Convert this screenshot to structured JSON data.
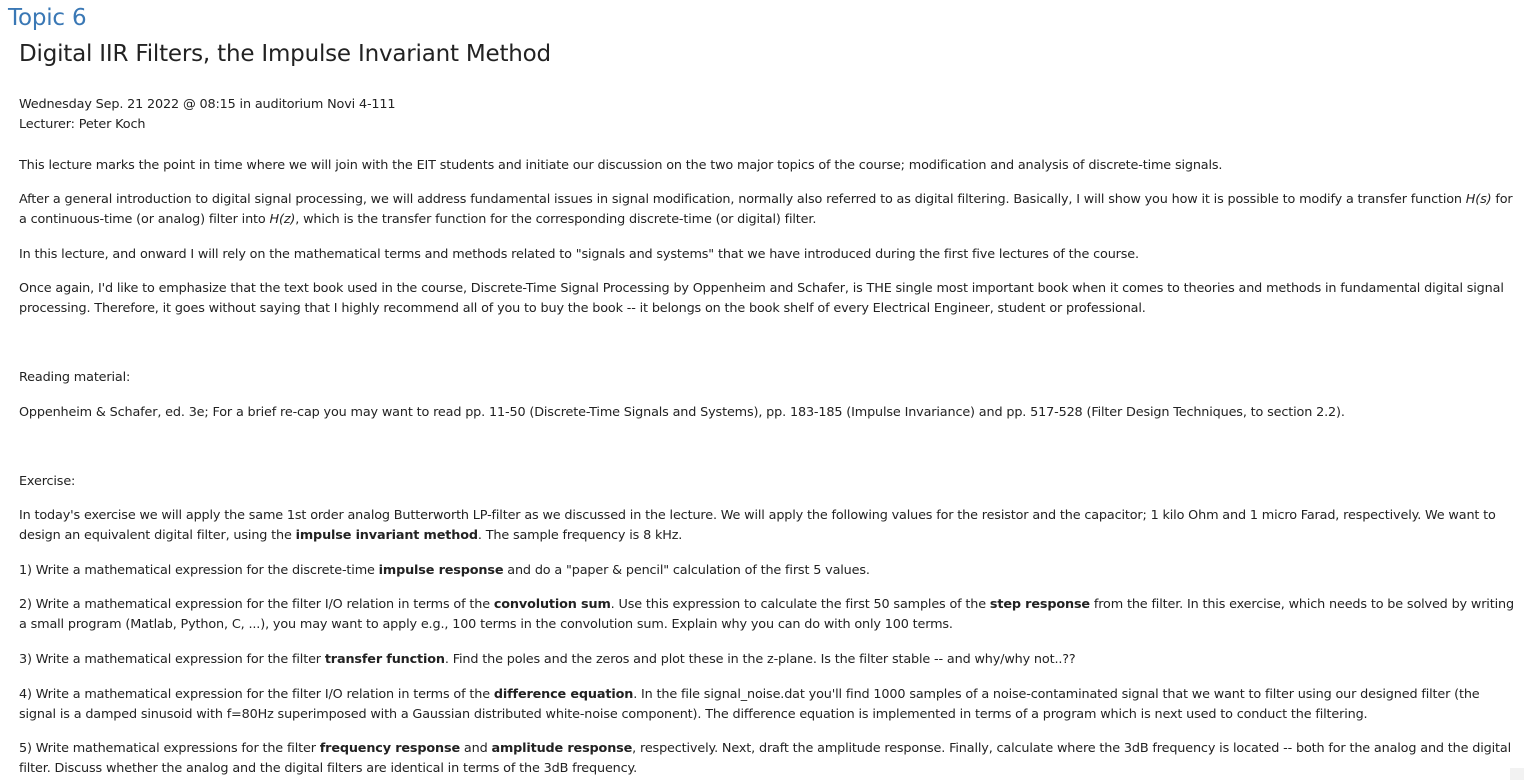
{
  "section": {
    "topic_link": "Topic 6",
    "title": "Digital IIR Filters, the Impulse Invariant Method"
  },
  "meta": {
    "date_line": "Wednesday Sep. 21 2022 @ 08:15 in auditorium Novi 4-111",
    "lecturer_line": "Lecturer: Peter Koch"
  },
  "intro": {
    "p1": "This lecture marks the point in time where we will join with the EIT students and initiate our discussion on the two major topics of the course; modification and analysis of discrete-time signals.",
    "p2_a": "After a general introduction to digital signal processing, we will address fundamental issues in signal modification, normally also referred to as digital filtering. Basically, I will show you how it is possible to modify a transfer function ",
    "p2_hs": "H(s)",
    "p2_b": " for a continuous-time (or analog) filter into ",
    "p2_hz": "H(z)",
    "p2_c": ", which is the transfer function for the corresponding discrete-time (or digital) filter.",
    "p3": "In this lecture, and onward I will rely on the mathematical terms and methods related to \"signals and systems\" that we have introduced during the first five lectures of the course.",
    "p4": "Once again, I'd like to emphasize that the text book used in the course, Discrete-Time Signal Processing by Oppenheim and Schafer, is THE single most important book when it comes to theories and methods in fundamental digital signal processing. Therefore, it goes without saying that I highly recommend all of you to buy the book -- it belongs on the book shelf of every Electrical Engineer, student or professional."
  },
  "reading": {
    "heading": "Reading material:",
    "text": "Oppenheim & Schafer, ed. 3e; For a brief re-cap you may want to read pp. 11-50 (Discrete-Time Signals and Systems), pp. 183-185 (Impulse Invariance) and pp. 517-528 (Filter Design Techniques, to section 2.2)."
  },
  "exercise": {
    "heading": "Exercise:",
    "intro_a": "In today's exercise we will apply the same 1st order analog Butterworth LP-filter as we discussed in the lecture. We will apply the following values for the resistor and the capacitor; 1 kilo Ohm and 1 micro Farad, respectively. We want to design an equivalent digital filter, using the ",
    "intro_bold": "impulse invariant method",
    "intro_b": ". The sample frequency is 8 kHz.",
    "q1_a": "1) Write a mathematical expression for the discrete-time ",
    "q1_bold": "impulse response",
    "q1_b": " and do a \"paper & pencil\" calculation of the first 5 values.",
    "q2_a": "2) Write a mathematical expression for the filter I/O relation in terms of the ",
    "q2_bold1": "convolution sum",
    "q2_b": ". Use this expression to calculate the first 50 samples of the ",
    "q2_bold2": "step response",
    "q2_c": " from the filter. In this exercise, which needs to be solved by writing a small program (Matlab, Python, C, ...), you may want to apply e.g., 100 terms in the convolution sum. Explain why you can do with only 100 terms.",
    "q3_a": "3) Write a mathematical expression for the filter ",
    "q3_bold": "transfer function",
    "q3_b": ". Find the poles and the zeros and plot these in the z-plane. Is the filter stable -- and why/why not..??",
    "q4_a": "4) Write a mathematical expression for the filter I/O relation in terms of the ",
    "q4_bold": "difference equation",
    "q4_b": ". In the file signal_noise.dat you'll find 1000 samples of a noise-contaminated signal that we want to filter using our designed filter (the signal is a damped sinusoid with f=80Hz superimposed with a Gaussian distributed white-noise component). The difference equation is implemented in terms of a program which is next used to conduct the filtering.",
    "q5_a": "5) Write mathematical expressions for the filter ",
    "q5_bold1": "frequency response",
    "q5_b": " and ",
    "q5_bold2": "amplitude response",
    "q5_c": ", respectively. Next, draft the amplitude response. Finally, calculate where the 3dB frequency is located -- both for the analog and the digital filter. Discuss whether the analog and the digital filters are identical in terms of the 3dB frequency."
  }
}
